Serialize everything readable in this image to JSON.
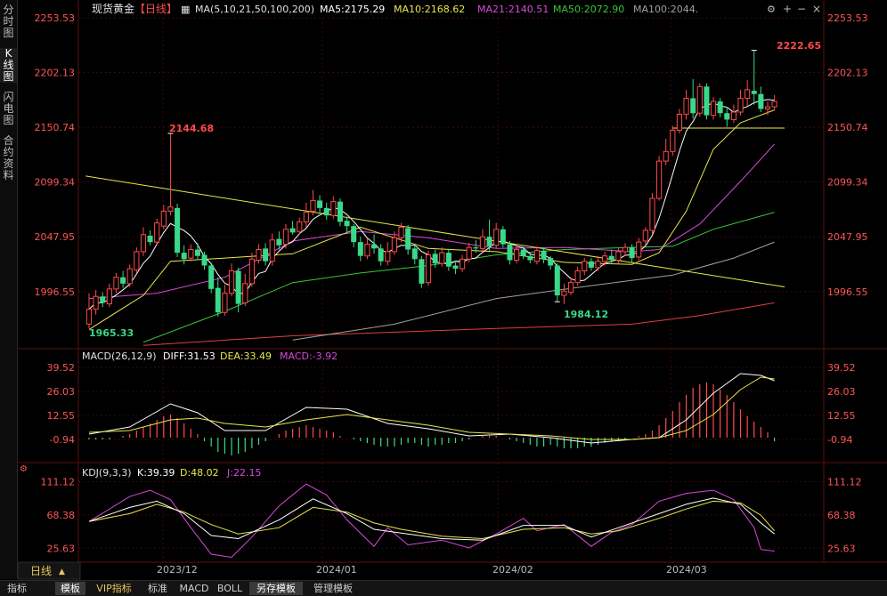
{
  "colors": {
    "background": "#000000",
    "grid": "#3a0a0a",
    "up": "#ff4a4a",
    "down": "#39d98a",
    "axis_text": "#ff5555",
    "ma5": "#ffffff",
    "ma10": "#e8e84a",
    "ma21": "#d84ad8",
    "ma50": "#3cc43c",
    "ma100": "#a0a0a0",
    "ma200": "#e04040",
    "trendline": "#e8e84a"
  },
  "left_tabs": [
    {
      "label": "分时图",
      "active": false
    },
    {
      "label": "K线图",
      "active": true
    },
    {
      "label": "闪电图",
      "active": false
    },
    {
      "label": "合约资料",
      "active": false
    }
  ],
  "header": {
    "symbol": "现货黄金",
    "period": "【日线】",
    "ma_def": "MA(5,10,21,50,100,200)",
    "ma5": "MA5:2175.29",
    "ma10": "MA10:2168.62",
    "ma21": "MA21:2140.51",
    "ma50": "MA50:2072.90",
    "ma100": "MA100:2044."
  },
  "window_buttons": {
    "settings": "⚙",
    "zoom_in": "+",
    "zoom_out": "−",
    "close": "×"
  },
  "price_axis": [
    "2253.53",
    "2202.13",
    "2150.74",
    "2099.34",
    "2047.95",
    "1996.55"
  ],
  "price_annotations": {
    "high": "2222.65",
    "mid": "2144.68",
    "low": "1984.12",
    "start": "1965.33"
  },
  "macd": {
    "title": "MACD(26,12,9)",
    "diff": "DIFF:31.53",
    "dea": "DEA:33.49",
    "macd": "MACD:-3.92",
    "axis": [
      "39.52",
      "26.03",
      "12.55",
      "-0.94"
    ]
  },
  "kdj": {
    "title": "KDJ(9,3,3)",
    "k": "K:39.39",
    "d": "D:48.02",
    "j": "J:22.15",
    "axis": [
      "111.12",
      "68.38",
      "25.63"
    ]
  },
  "time_axis": [
    "2023/12",
    "2024/01",
    "2024/02",
    "2024/03"
  ],
  "period_selector": {
    "label": "日线",
    "arrow": "▲"
  },
  "bottom_tabs": [
    {
      "label": "指标",
      "active": false
    },
    {
      "label": "模板",
      "active": true
    },
    {
      "label": "VIP指标",
      "active": false,
      "vip": true
    },
    {
      "label": "标准",
      "active": false
    },
    {
      "label": "MACD",
      "active": false
    },
    {
      "label": "BOLL",
      "active": false
    },
    {
      "label": "另存模板",
      "active": true
    },
    {
      "label": "管理模板",
      "active": false
    }
  ],
  "chart_data": {
    "type": "candlestick",
    "y_range": [
      1944.6,
      2253.53
    ],
    "candles": [
      [
        1966,
        1980,
        1995,
        1962
      ],
      [
        1980,
        1992,
        1998,
        1975
      ],
      [
        1992,
        1986,
        1996,
        1982
      ],
      [
        1985,
        1999,
        2004,
        1982
      ],
      [
        1999,
        2010,
        2014,
        1995
      ],
      [
        2010,
        2004,
        2016,
        2000
      ],
      [
        2004,
        2018,
        2022,
        2001
      ],
      [
        2017,
        2034,
        2038,
        2014
      ],
      [
        2034,
        2050,
        2057,
        2030
      ],
      [
        2049,
        2043,
        2054,
        2040
      ],
      [
        2043,
        2061,
        2065,
        2040
      ],
      [
        2058,
        2072,
        2078,
        2055
      ],
      [
        2072,
        2076,
        2145,
        2068
      ],
      [
        2075,
        2033,
        2079,
        2029
      ],
      [
        2033,
        2027,
        2040,
        2022
      ],
      [
        2028,
        2036,
        2041,
        2025
      ],
      [
        2036,
        2030,
        2042,
        2026
      ],
      [
        2031,
        2021,
        2034,
        2017
      ],
      [
        2021,
        1999,
        2024,
        1995
      ],
      [
        2000,
        1977,
        2010,
        1973
      ],
      [
        1977,
        1995,
        2003,
        1974
      ],
      [
        1995,
        2016,
        2023,
        1992
      ],
      [
        2016,
        1985,
        2019,
        1977
      ],
      [
        1986,
        2004,
        2013,
        1983
      ],
      [
        2004,
        2027,
        2033,
        2001
      ],
      [
        2026,
        2036,
        2041,
        2023
      ],
      [
        2037,
        2025,
        2042,
        2021
      ],
      [
        2025,
        2045,
        2051,
        2021
      ],
      [
        2046,
        2040,
        2053,
        2036
      ],
      [
        2041,
        2055,
        2060,
        2037
      ],
      [
        2056,
        2052,
        2063,
        2050
      ],
      [
        2053,
        2062,
        2066,
        2050
      ],
      [
        2062,
        2071,
        2080,
        2057
      ],
      [
        2072,
        2082,
        2092,
        2068
      ],
      [
        2082,
        2075,
        2087,
        2070
      ],
      [
        2075,
        2068,
        2080,
        2064
      ],
      [
        2068,
        2081,
        2086,
        2065
      ],
      [
        2081,
        2062,
        2084,
        2058
      ],
      [
        2063,
        2058,
        2067,
        2051
      ],
      [
        2058,
        2043,
        2060,
        2038
      ],
      [
        2043,
        2030,
        2048,
        2025
      ],
      [
        2030,
        2041,
        2046,
        2027
      ],
      [
        2041,
        2037,
        2050,
        2032
      ],
      [
        2037,
        2025,
        2041,
        2021
      ],
      [
        2025,
        2034,
        2043,
        2021
      ],
      [
        2034,
        2047,
        2053,
        2031
      ],
      [
        2047,
        2057,
        2061,
        2043
      ],
      [
        2056,
        2036,
        2059,
        2031
      ],
      [
        2037,
        2027,
        2041,
        2022
      ],
      [
        2027,
        2004,
        2030,
        2000
      ],
      [
        2005,
        2031,
        2035,
        2002
      ],
      [
        2032,
        2023,
        2036,
        2019
      ],
      [
        2023,
        2033,
        2038,
        2020
      ],
      [
        2033,
        2020,
        2036,
        2016
      ],
      [
        2021,
        2018,
        2024,
        2013
      ],
      [
        2018,
        2027,
        2031,
        2015
      ],
      [
        2027,
        2038,
        2042,
        2024
      ],
      [
        2038,
        2037,
        2045,
        2033
      ],
      [
        2037,
        2048,
        2055,
        2034
      ],
      [
        2048,
        2039,
        2064,
        2035
      ],
      [
        2040,
        2055,
        2061,
        2037
      ],
      [
        2055,
        2041,
        2058,
        2038
      ],
      [
        2041,
        2026,
        2044,
        2022
      ],
      [
        2026,
        2036,
        2040,
        2023
      ],
      [
        2036,
        2030,
        2039,
        2027
      ],
      [
        2030,
        2026,
        2033,
        2023
      ],
      [
        2025,
        2035,
        2039,
        2022
      ],
      [
        2035,
        2027,
        2038,
        2023
      ],
      [
        2028,
        2021,
        2030,
        2017
      ],
      [
        2021,
        1993,
        2023,
        1987
      ],
      [
        1993,
        1997,
        2004,
        1985
      ],
      [
        1996,
        2005,
        2010,
        1993
      ],
      [
        2005,
        2016,
        2020,
        2002
      ],
      [
        2016,
        2025,
        2028,
        2012
      ],
      [
        2025,
        2019,
        2028,
        2016
      ],
      [
        2019,
        2025,
        2030,
        2016
      ],
      [
        2025,
        2030,
        2034,
        2021
      ],
      [
        2030,
        2026,
        2036,
        2023
      ],
      [
        2026,
        2034,
        2038,
        2023
      ],
      [
        2034,
        2038,
        2042,
        2030
      ],
      [
        2038,
        2028,
        2041,
        2024
      ],
      [
        2029,
        2043,
        2047,
        2026
      ],
      [
        2044,
        2054,
        2057,
        2040
      ],
      [
        2054,
        2084,
        2089,
        2051
      ],
      [
        2084,
        2119,
        2124,
        2082
      ],
      [
        2119,
        2128,
        2140,
        2115
      ],
      [
        2128,
        2148,
        2152,
        2124
      ],
      [
        2148,
        2163,
        2168,
        2145
      ],
      [
        2163,
        2178,
        2186,
        2158
      ],
      [
        2178,
        2164,
        2196,
        2159
      ],
      [
        2164,
        2189,
        2192,
        2161
      ],
      [
        2189,
        2162,
        2192,
        2158
      ],
      [
        2162,
        2175,
        2179,
        2158
      ],
      [
        2175,
        2164,
        2178,
        2160
      ],
      [
        2164,
        2158,
        2170,
        2151
      ],
      [
        2158,
        2165,
        2172,
        2155
      ],
      [
        2165,
        2178,
        2186,
        2162
      ],
      [
        2178,
        2186,
        2195,
        2171
      ],
      [
        2185,
        2182,
        2223,
        2172
      ],
      [
        2182,
        2168,
        2189,
        2165
      ],
      [
        2168,
        2170,
        2175,
        2162
      ],
      [
        2170,
        2175,
        2181,
        2167
      ]
    ],
    "ma_lines": {
      "ma10": [
        [
          0,
          1961
        ],
        [
          8,
          1993
        ],
        [
          12,
          2025
        ],
        [
          20,
          2028
        ],
        [
          30,
          2032
        ],
        [
          40,
          2057
        ],
        [
          50,
          2037
        ],
        [
          60,
          2034
        ],
        [
          70,
          2024
        ],
        [
          80,
          2022
        ],
        [
          84,
          2033
        ],
        [
          88,
          2072
        ],
        [
          92,
          2130
        ],
        [
          96,
          2155
        ],
        [
          101,
          2167
        ]
      ],
      "ma21": [
        [
          0,
          1990
        ],
        [
          10,
          1995
        ],
        [
          20,
          2010
        ],
        [
          30,
          2044
        ],
        [
          40,
          2053
        ],
        [
          50,
          2047
        ],
        [
          60,
          2037
        ],
        [
          70,
          2038
        ],
        [
          80,
          2034
        ],
        [
          84,
          2036
        ],
        [
          90,
          2060
        ],
        [
          96,
          2100
        ],
        [
          101,
          2135
        ]
      ],
      "ma50": [
        [
          8,
          1949
        ],
        [
          20,
          1978
        ],
        [
          30,
          2005
        ],
        [
          40,
          2014
        ],
        [
          50,
          2021
        ],
        [
          60,
          2031
        ],
        [
          70,
          2036
        ],
        [
          80,
          2038
        ],
        [
          86,
          2039
        ],
        [
          92,
          2055
        ],
        [
          101,
          2071
        ]
      ],
      "ma100": [
        [
          30,
          1951
        ],
        [
          45,
          1966
        ],
        [
          60,
          1990
        ],
        [
          75,
          2003
        ],
        [
          86,
          2012
        ],
        [
          95,
          2028
        ],
        [
          101,
          2043
        ]
      ],
      "ma200": [
        [
          8,
          1946
        ],
        [
          30,
          1955
        ],
        [
          60,
          1962
        ],
        [
          80,
          1966
        ],
        [
          90,
          1974
        ],
        [
          101,
          1986
        ]
      ],
      "trendline": [
        [
          -0.5,
          2105
        ],
        [
          102.5,
          2001
        ]
      ],
      "support": [
        [
          86,
          2150
        ],
        [
          102.5,
          2150
        ]
      ]
    },
    "macd_range": [
      -10,
      41
    ],
    "macd_hist": [
      -1,
      -1,
      -1,
      -1,
      0,
      1,
      2,
      4,
      6,
      8,
      10,
      12,
      13,
      11,
      8,
      5,
      2,
      -2,
      -5,
      -8,
      -9,
      -10,
      -9,
      -8,
      -6,
      -4,
      -2,
      0,
      2,
      4,
      5,
      6,
      7,
      6,
      5,
      4,
      3,
      1,
      0,
      -1,
      -2,
      -3,
      -4,
      -5,
      -5,
      -5,
      -4,
      -3,
      -3,
      -4,
      -5,
      -4,
      -4,
      -3,
      -3,
      -2,
      -1,
      0,
      1,
      1,
      1,
      0,
      -1,
      -2,
      -3,
      -4,
      -5,
      -5,
      -4,
      -5,
      -6,
      -6,
      -6,
      -5,
      -5,
      -4,
      -3,
      -2,
      -2,
      -1,
      0,
      1,
      2,
      4,
      7,
      11,
      15,
      20,
      24,
      28,
      30,
      31,
      30,
      27,
      24,
      20,
      16,
      12,
      9,
      6,
      3,
      -2
    ],
    "macd_diff": [
      [
        0,
        2
      ],
      [
        6,
        6
      ],
      [
        12,
        19
      ],
      [
        16,
        14
      ],
      [
        20,
        4
      ],
      [
        26,
        4
      ],
      [
        32,
        17
      ],
      [
        38,
        16
      ],
      [
        44,
        8
      ],
      [
        50,
        5
      ],
      [
        56,
        1
      ],
      [
        62,
        2
      ],
      [
        68,
        0
      ],
      [
        74,
        -3
      ],
      [
        80,
        -1
      ],
      [
        84,
        0
      ],
      [
        88,
        10
      ],
      [
        92,
        25
      ],
      [
        96,
        36
      ],
      [
        99,
        35
      ],
      [
        101,
        32
      ]
    ],
    "macd_dea": [
      [
        0,
        3
      ],
      [
        6,
        4
      ],
      [
        12,
        10
      ],
      [
        16,
        11
      ],
      [
        20,
        8
      ],
      [
        26,
        6
      ],
      [
        32,
        10
      ],
      [
        38,
        13
      ],
      [
        44,
        10
      ],
      [
        50,
        7
      ],
      [
        56,
        3
      ],
      [
        62,
        2
      ],
      [
        68,
        1
      ],
      [
        74,
        -1
      ],
      [
        80,
        -1
      ],
      [
        84,
        0
      ],
      [
        88,
        4
      ],
      [
        92,
        13
      ],
      [
        96,
        27
      ],
      [
        99,
        34
      ],
      [
        101,
        33
      ]
    ],
    "kdj_range": [
      10,
      115
    ],
    "kdj_k": [
      [
        0,
        60
      ],
      [
        6,
        78
      ],
      [
        10,
        86
      ],
      [
        14,
        70
      ],
      [
        18,
        42
      ],
      [
        22,
        38
      ],
      [
        28,
        62
      ],
      [
        33,
        89
      ],
      [
        38,
        70
      ],
      [
        42,
        50
      ],
      [
        46,
        45
      ],
      [
        52,
        38
      ],
      [
        58,
        36
      ],
      [
        64,
        55
      ],
      [
        70,
        55
      ],
      [
        74,
        40
      ],
      [
        78,
        52
      ],
      [
        84,
        70
      ],
      [
        88,
        82
      ],
      [
        92,
        90
      ],
      [
        96,
        82
      ],
      [
        99,
        58
      ],
      [
        101,
        44
      ]
    ],
    "kdj_d": [
      [
        0,
        60
      ],
      [
        6,
        70
      ],
      [
        10,
        82
      ],
      [
        14,
        72
      ],
      [
        18,
        56
      ],
      [
        22,
        44
      ],
      [
        28,
        52
      ],
      [
        33,
        78
      ],
      [
        38,
        72
      ],
      [
        42,
        58
      ],
      [
        46,
        50
      ],
      [
        52,
        41
      ],
      [
        58,
        38
      ],
      [
        64,
        50
      ],
      [
        70,
        52
      ],
      [
        74,
        44
      ],
      [
        78,
        48
      ],
      [
        84,
        64
      ],
      [
        88,
        76
      ],
      [
        92,
        86
      ],
      [
        96,
        84
      ],
      [
        99,
        68
      ],
      [
        101,
        48
      ]
    ],
    "kdj_j": [
      [
        0,
        60
      ],
      [
        6,
        92
      ],
      [
        9,
        100
      ],
      [
        12,
        88
      ],
      [
        15,
        52
      ],
      [
        18,
        18
      ],
      [
        21,
        14
      ],
      [
        24,
        40
      ],
      [
        28,
        80
      ],
      [
        32,
        108
      ],
      [
        35,
        94
      ],
      [
        38,
        62
      ],
      [
        42,
        28
      ],
      [
        44,
        52
      ],
      [
        47,
        30
      ],
      [
        52,
        36
      ],
      [
        56,
        26
      ],
      [
        60,
        44
      ],
      [
        64,
        64
      ],
      [
        66,
        48
      ],
      [
        70,
        56
      ],
      [
        74,
        28
      ],
      [
        77,
        46
      ],
      [
        80,
        56
      ],
      [
        84,
        86
      ],
      [
        88,
        96
      ],
      [
        92,
        100
      ],
      [
        95,
        88
      ],
      [
        98,
        52
      ],
      [
        99,
        24
      ],
      [
        101,
        22
      ]
    ]
  }
}
